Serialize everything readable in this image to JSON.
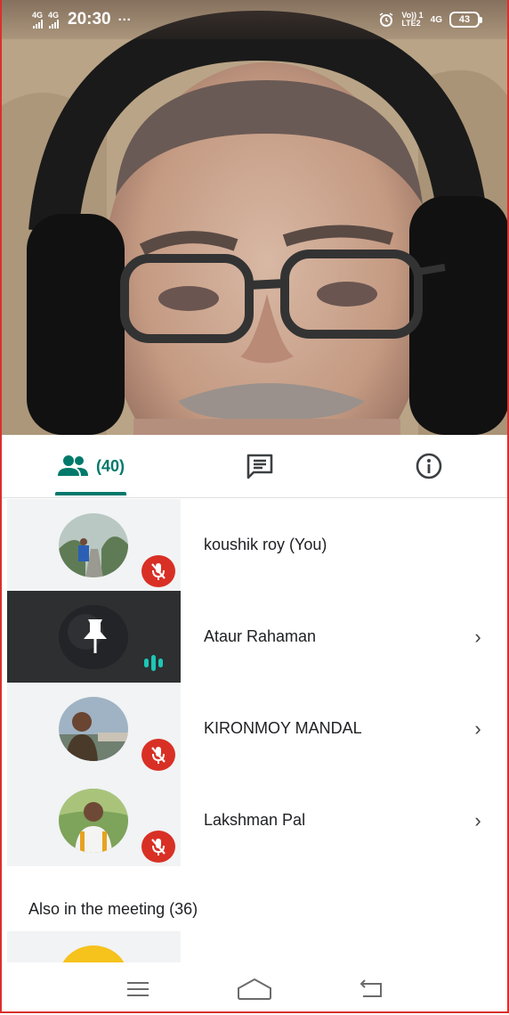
{
  "status_bar": {
    "signal1_label": "4G",
    "signal2_label": "4G",
    "time": "20:30",
    "dots": "···",
    "volte": "Vo)) 1",
    "lte": "LTE2",
    "net": "4G",
    "battery": "43"
  },
  "tabs": {
    "people_count": "(40)",
    "people_icon": "people-icon",
    "chat_icon": "chat-icon",
    "info_icon": "info-icon",
    "accent": "#00796b"
  },
  "participants": [
    {
      "name": "koushik roy (You)",
      "mic": "muted"
    },
    {
      "name": "Ataur Rahaman",
      "mic": "speaking",
      "pinned": true
    },
    {
      "name": "KIRONMOY MANDAL",
      "mic": "muted"
    },
    {
      "name": "Lakshman Pal",
      "mic": "muted"
    }
  ],
  "also_in_meeting": "Also in the meeting (36)",
  "chevron": "›",
  "colors": {
    "mute_red": "#d93025",
    "speaking_teal": "#1ec6b5"
  },
  "nav_bar": {
    "menu_icon": "menu-icon",
    "home_icon": "home-icon",
    "back_icon": "back-icon"
  }
}
